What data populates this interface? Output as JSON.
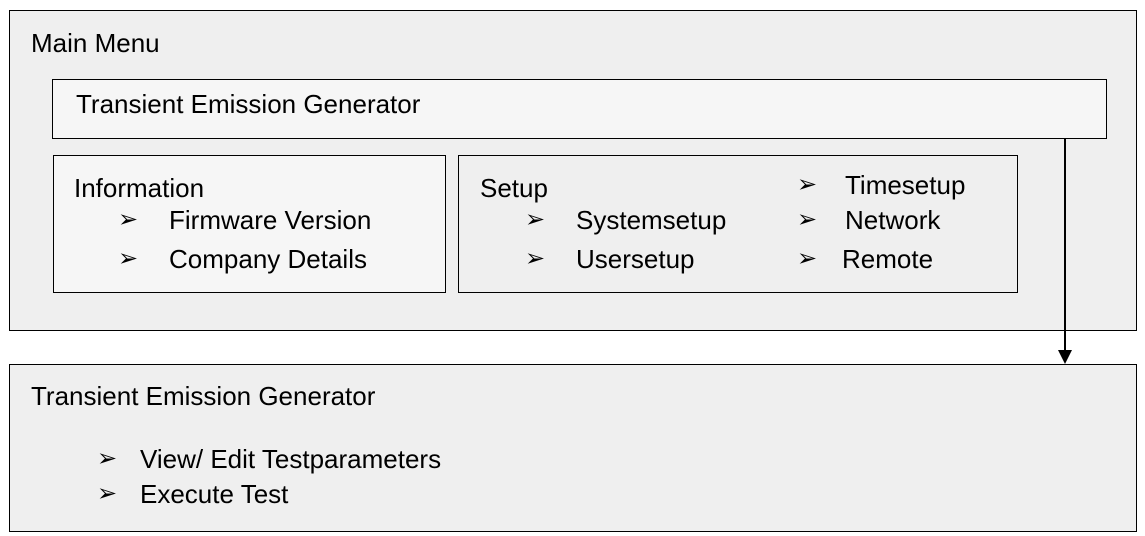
{
  "main_menu": {
    "title": "Main Menu",
    "generator_label": "Transient Emission Generator"
  },
  "information": {
    "title": "Information",
    "items": [
      "Firmware Version",
      "Company Details"
    ]
  },
  "setup": {
    "title": "Setup",
    "left_items": [
      "Systemsetup",
      "Usersetup"
    ],
    "right_items": [
      "Timesetup",
      "Network",
      "Remote"
    ]
  },
  "generator_panel": {
    "title": "Transient Emission Generator",
    "items": [
      "View/ Edit Testparameters",
      "Execute Test"
    ]
  },
  "bullet_glyph": "➢",
  "colors": {
    "panel_fill": "#efefef",
    "inner_fill": "#f6f6f6",
    "border": "#000000"
  }
}
